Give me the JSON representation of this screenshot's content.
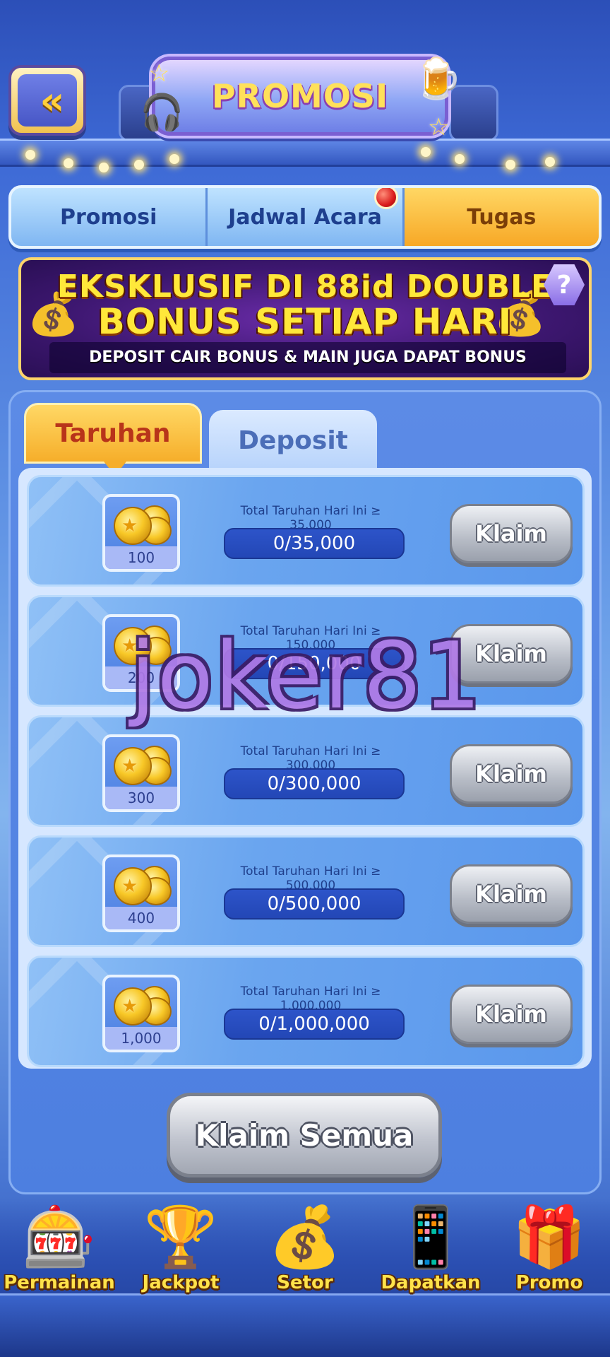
{
  "header": {
    "back_glyph": "«",
    "title": "PROMOSI"
  },
  "main_tabs": [
    {
      "label": "Promosi",
      "active": false,
      "badge": false
    },
    {
      "label": "Jadwal Acara",
      "active": false,
      "badge": true
    },
    {
      "label": "Tugas",
      "active": true,
      "badge": false
    }
  ],
  "banner": {
    "line1": "EKSKLUSIF DI 88id DOUBLE",
    "line2": "BONUS SETIAP HARI",
    "line3": "DEPOSIT CAIR BONUS  & MAIN JUGA DAPAT BONUS",
    "help_glyph": "?"
  },
  "sub_tabs": [
    {
      "label": "Taruhan",
      "active": true
    },
    {
      "label": "Deposit",
      "active": false
    }
  ],
  "tasks": [
    {
      "reward": "100",
      "label": "Total Taruhan Hari Ini ≥ 35,000",
      "progress": "0/35,000",
      "progress_fraction": 0,
      "button": "Klaim"
    },
    {
      "reward": "200",
      "label": "Total Taruhan Hari Ini ≥ 150,000",
      "progress": "0/150,000",
      "progress_fraction": 0,
      "button": "Klaim"
    },
    {
      "reward": "300",
      "label": "Total Taruhan Hari Ini ≥ 300,000",
      "progress": "0/300,000",
      "progress_fraction": 0,
      "button": "Klaim"
    },
    {
      "reward": "400",
      "label": "Total Taruhan Hari Ini ≥ 500,000",
      "progress": "0/500,000",
      "progress_fraction": 0,
      "button": "Klaim"
    },
    {
      "reward": "1,000",
      "label": "Total Taruhan Hari Ini ≥ 1,000,000",
      "progress": "0/1,000,000",
      "progress_fraction": 0,
      "button": "Klaim"
    }
  ],
  "claim_all_label": "Klaim Semua",
  "watermark": "joker81",
  "bottom_nav": [
    {
      "label": "Permainan",
      "icon": "slot-machine-icon",
      "glyph": "🎰"
    },
    {
      "label": "Jackpot",
      "icon": "trophy-icon",
      "glyph": "🏆"
    },
    {
      "label": "Setor",
      "icon": "treasure-chest-icon",
      "glyph": "💰"
    },
    {
      "label": "Dapatkan",
      "icon": "phone-coins-icon",
      "glyph": "📱"
    },
    {
      "label": "Promo",
      "icon": "gift-box-icon",
      "glyph": "🎁"
    }
  ],
  "colors": {
    "accent_orange": "#f6ae2a",
    "button_gray": "#b7bcc6",
    "title_yellow": "#ffe15a",
    "badge_red": "#d91b1b"
  }
}
